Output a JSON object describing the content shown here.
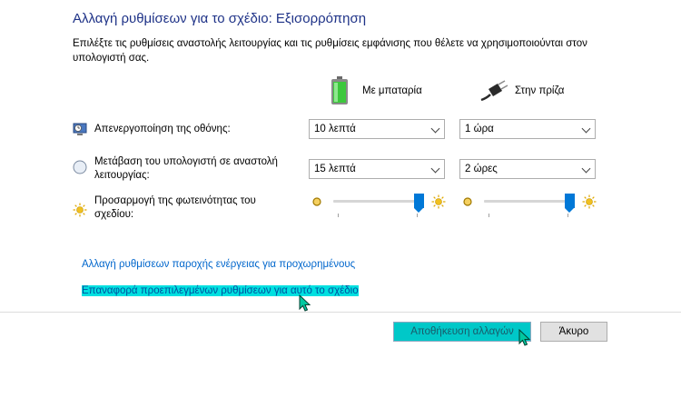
{
  "header": {
    "title": "Αλλαγή ρυθμίσεων για το σχέδιο: Εξισορρόπηση",
    "description": "Επιλέξτε τις ρυθμίσεις αναστολής λειτουργίας και τις ρυθμίσεις εμφάνισης που θέλετε να χρησιμοποιούνται στον υπολογιστή σας."
  },
  "columns": {
    "battery_label": "Με μπαταρία",
    "battery_icon": "battery-icon",
    "plugged_label": "Στην πρίζα",
    "plugged_icon": "power-plug-icon"
  },
  "rows": {
    "display_off": {
      "label": "Απενεργοποίηση της οθόνης:",
      "icon": "monitor-icon",
      "battery_value": "10 λεπτά",
      "plugged_value": "1 ώρα"
    },
    "sleep": {
      "label": "Μετάβαση του υπολογιστή σε αναστολή λειτουργίας:",
      "icon": "sleep-moon-icon",
      "battery_value": "15 λεπτά",
      "plugged_value": "2 ώρες"
    },
    "brightness": {
      "label": "Προσαρμογή της φωτεινότητας του σχεδίου:",
      "icon": "brightness-sun-icon",
      "battery_level": 1.0,
      "plugged_level": 1.0
    }
  },
  "links": {
    "advanced": "Αλλαγή ρυθμίσεων παροχής ενέργειας για προχωρημένους",
    "restore": "Επαναφορά προεπιλεγμένων ρυθμίσεων για αυτό το σχέδιο"
  },
  "buttons": {
    "save": "Αποθήκευση αλλαγών",
    "cancel": "Άκυρο"
  },
  "colors": {
    "title": "#1e3287",
    "link": "#0066cc",
    "highlight": "#00e0e0",
    "slider_accent": "#0078d7"
  }
}
